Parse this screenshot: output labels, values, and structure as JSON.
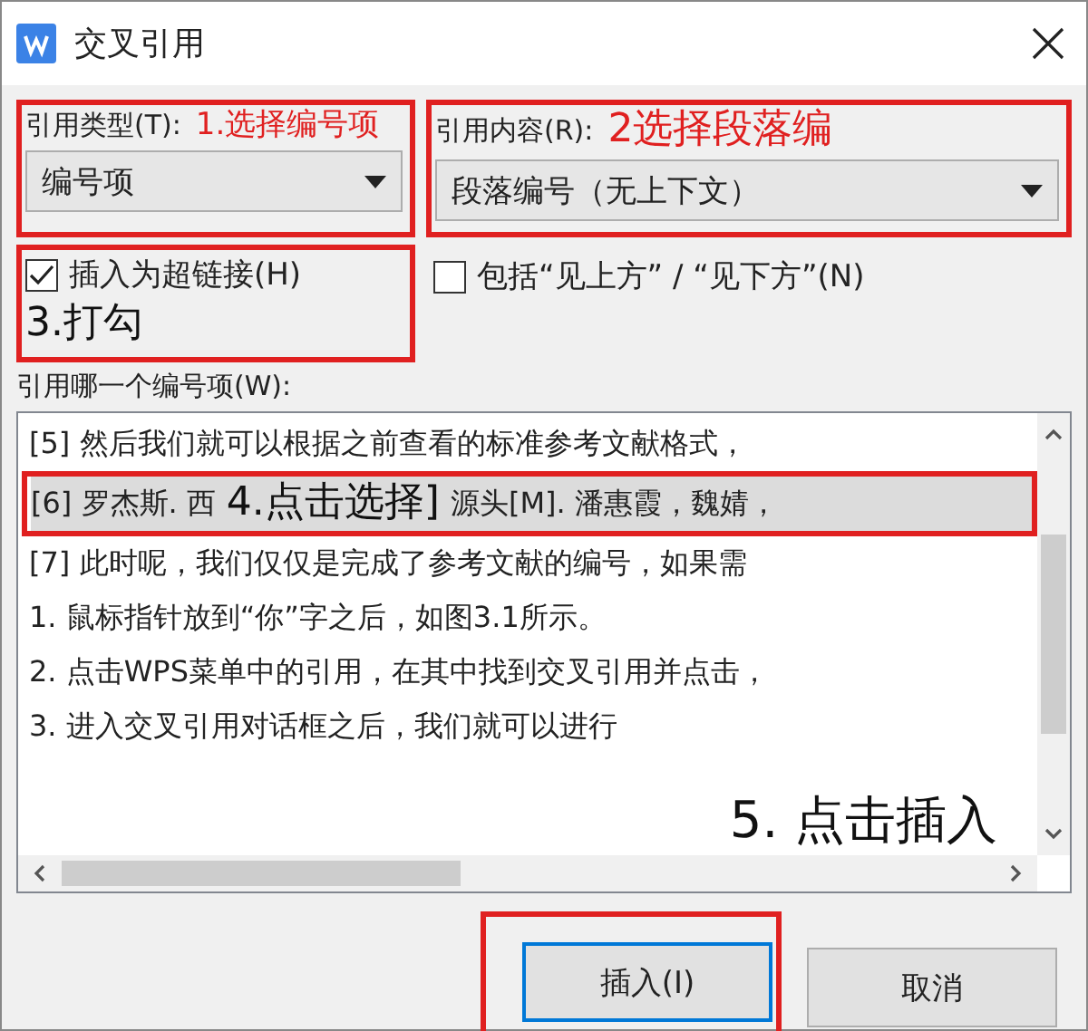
{
  "window": {
    "title": "交叉引用"
  },
  "reference_type": {
    "label": "引用类型(T):",
    "value": "编号项"
  },
  "reference_content": {
    "label": "引用内容(R):",
    "value": "段落编号（无上下文）"
  },
  "checkboxes": [
    {
      "label": "插入为超链接(H)",
      "checked": true
    },
    {
      "label": "包括“见上方” / “见下方”(N)",
      "checked": false
    }
  ],
  "list": {
    "label": "引用哪一个编号项(W):",
    "items": [
      {
        "parts": [
          "[5] 然后我们就可以根据之前查看的标准参考文献格式，"
        ],
        "selected": false
      },
      {
        "parts": [
          "[6] 罗杰斯. 西",
          "源头[M]. 潘惠霞，魏婧，"
        ],
        "selected": true
      },
      {
        "parts": [
          "[7] 此时呢，我们仅仅是完成了参考文献的编号，如果需"
        ],
        "selected": false
      },
      {
        "parts": [
          "1. 鼠标指针放到“你”字之后，如图3.1所示。"
        ],
        "selected": false
      },
      {
        "parts": [
          "2. 点击WPS菜单中的引用，在其中找到交叉引用并点击，"
        ],
        "selected": false
      },
      {
        "parts": [
          "3. 进入交叉引用对话框之后，我们就可以进行"
        ],
        "selected": false
      }
    ]
  },
  "buttons": [
    {
      "label": "插入(I)",
      "focused": true
    },
    {
      "label": "取消",
      "focused": false
    }
  ],
  "annotations": [
    {
      "text": "1.选择编号项"
    },
    {
      "text": "2选择段落编"
    },
    {
      "text": "3.打勾"
    },
    {
      "text": "4.点击选择]"
    },
    {
      "text": "5. 点击插入"
    }
  ]
}
